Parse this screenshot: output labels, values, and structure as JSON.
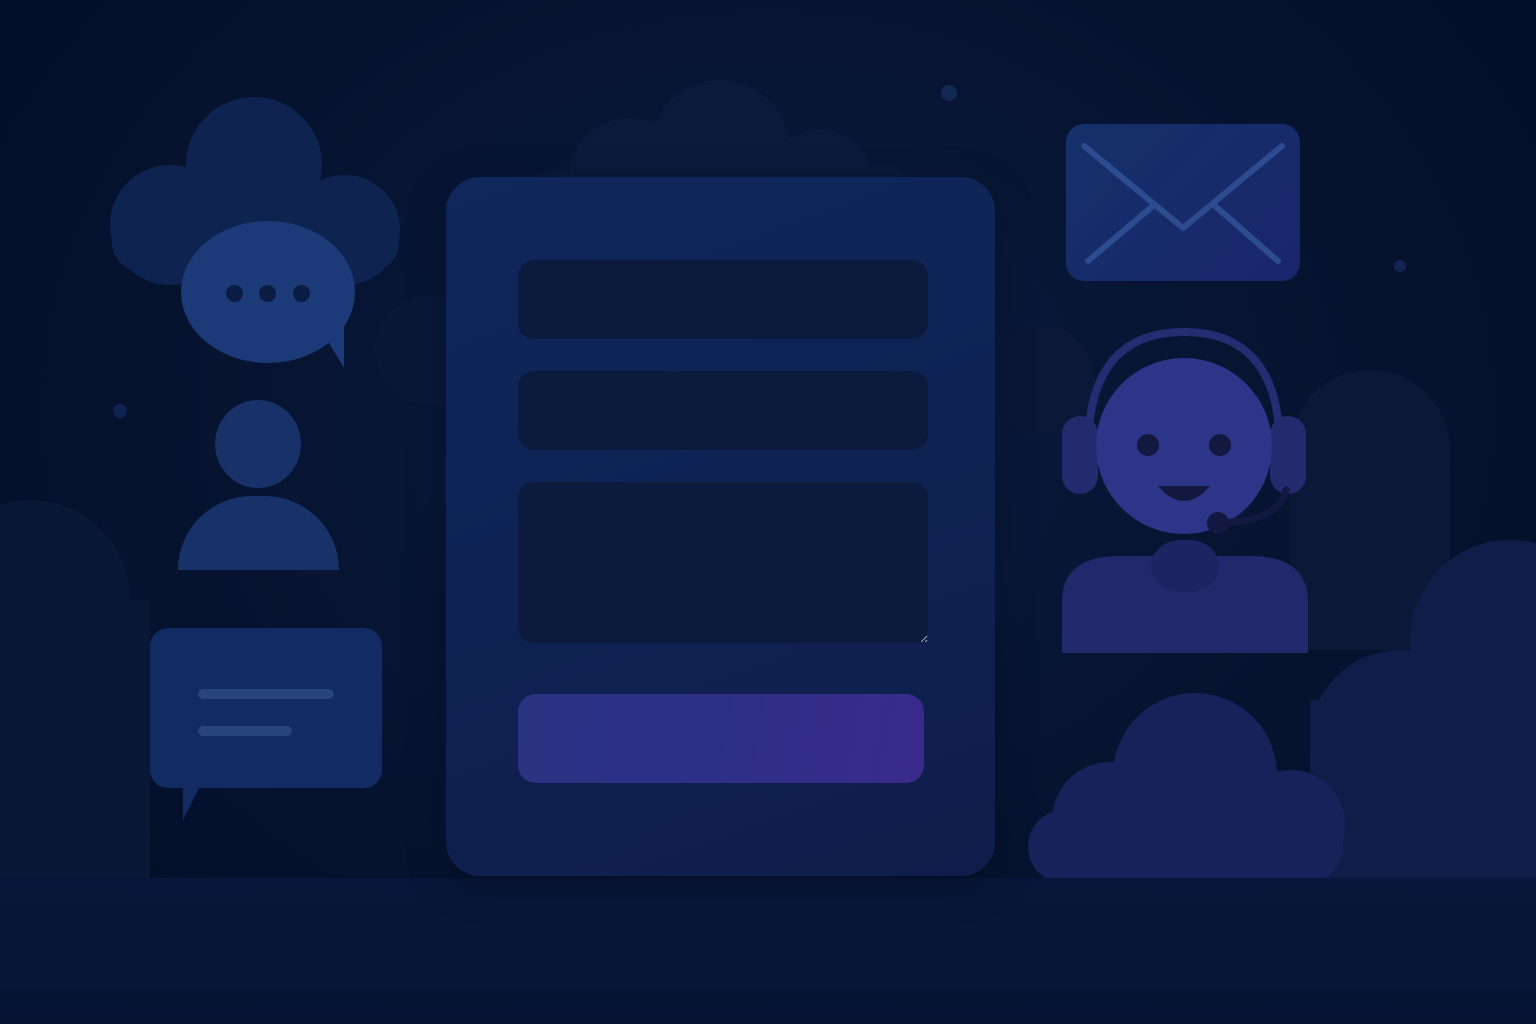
{
  "scene": {
    "description_icons": [
      "cloud-icon",
      "speech-bubble-icon",
      "user-icon",
      "chat-message-icon",
      "envelope-icon",
      "support-agent-icon"
    ]
  },
  "form": {
    "name_value": "",
    "email_value": "",
    "message_value": "",
    "submit_label": ""
  },
  "colors": {
    "background": "#04112d",
    "card": "#10275c",
    "field": "#0b1a3d",
    "submit": "#2d2f86",
    "accent_icon": "#2c3587"
  }
}
